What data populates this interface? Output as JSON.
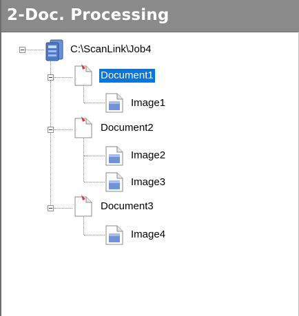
{
  "panel": {
    "title": "2-Doc. Processing"
  },
  "tree": {
    "root": {
      "label": "C:\\ScanLink\\Job4",
      "icon": "scanner-folder-icon"
    },
    "documents": [
      {
        "label": "Document1",
        "selected": true,
        "icon": "document-icon",
        "images": [
          {
            "label": "Image1",
            "icon": "image-icon"
          }
        ]
      },
      {
        "label": "Document2",
        "selected": false,
        "icon": "document-icon",
        "images": [
          {
            "label": "Image2",
            "icon": "image-icon"
          },
          {
            "label": "Image3",
            "icon": "image-icon"
          }
        ]
      },
      {
        "label": "Document3",
        "selected": false,
        "icon": "document-icon",
        "images": [
          {
            "label": "Image4",
            "icon": "image-icon"
          }
        ]
      }
    ]
  },
  "colors": {
    "title_bar": "#8a8a8a",
    "selection": "#0a74d9"
  }
}
